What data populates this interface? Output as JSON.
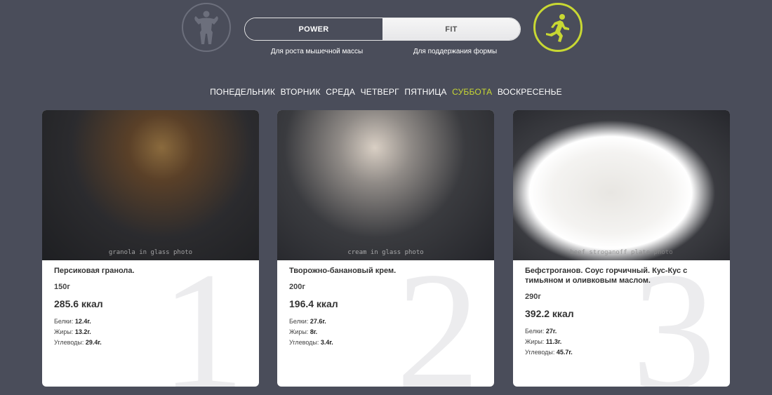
{
  "modes": {
    "power": {
      "label": "POWER",
      "description": "Для роста мышечной массы",
      "icon": "bodybuilder-icon"
    },
    "fit": {
      "label": "FIT",
      "description": "Для поддержания формы",
      "icon": "runner-icon"
    },
    "accent_color": "#c8d833"
  },
  "days": {
    "items": [
      "ПОНЕДЕЛЬНИК",
      "ВТОРНИК",
      "СРЕДА",
      "ЧЕТВЕРГ",
      "ПЯТНИЦА",
      "СУББОТА",
      "ВОСКРЕСЕНЬЕ"
    ],
    "active": "СУББОТА"
  },
  "meals": [
    {
      "number": "1",
      "name": "Персиковая гранола.",
      "weight": "150г",
      "kcal": "285.6 ккал",
      "protein_label": "Белки:",
      "protein": "12.4г.",
      "fat_label": "Жиры:",
      "fat": "13.2г.",
      "carbs_label": "Углеводы:",
      "carbs": "29.4г.",
      "image_label": "granola in glass photo"
    },
    {
      "number": "2",
      "name": "Творожно-банановый крем.",
      "weight": "200г",
      "kcal": "196.4 ккал",
      "protein_label": "Белки:",
      "protein": "27.6г.",
      "fat_label": "Жиры:",
      "fat": "8г.",
      "carbs_label": "Углеводы:",
      "carbs": "3.4г.",
      "image_label": "cream in glass photo"
    },
    {
      "number": "3",
      "name": "Бефстроганов. Соус горчичный. Кус-Кус с тимьяном и оливковым маслом.",
      "weight": "290г",
      "kcal": "392.2 ккал",
      "protein_label": "Белки:",
      "protein": "27г.",
      "fat_label": "Жиры:",
      "fat": "11.3г.",
      "carbs_label": "Углеводы:",
      "carbs": "45.7г.",
      "image_label": "beef stroganoff plate photo"
    }
  ]
}
